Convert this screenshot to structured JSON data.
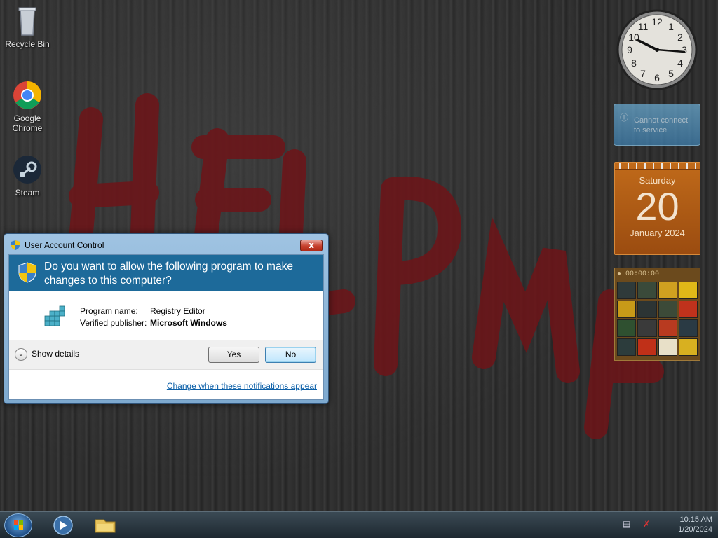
{
  "desktop": {
    "icons": [
      {
        "label": "Recycle Bin",
        "icon": "recycle-bin-icon"
      },
      {
        "label": "Google Chrome",
        "icon": "chrome-icon"
      },
      {
        "label": "Steam",
        "icon": "steam-icon"
      }
    ],
    "wallpaper_text": "HELP ME"
  },
  "gadgets": {
    "clock": {
      "numerals": [
        "12",
        "1",
        "2",
        "3",
        "4",
        "5",
        "6",
        "7",
        "8",
        "9",
        "10",
        "11"
      ],
      "time": "10:15"
    },
    "notice": {
      "text": "Cannot connect to service"
    },
    "calendar": {
      "day_name": "Saturday",
      "day": "20",
      "month_year": "January 2024"
    },
    "puzzle": {
      "timer": "00:00:00"
    }
  },
  "uac": {
    "title": "User Account Control",
    "close_label": "x",
    "question": "Do you want to allow the following program to make changes to this computer?",
    "program_name_label": "Program name:",
    "program_name_value": "Registry Editor",
    "publisher_label": "Verified publisher:",
    "publisher_value": "Microsoft Windows",
    "details_label": "Show details",
    "yes_label": "Yes",
    "no_label": "No",
    "link_label": "Change when these notifications appear"
  },
  "taskbar": {
    "items": [
      "start-orb",
      "media-player",
      "windows-explorer"
    ],
    "time": "10:15 AM",
    "date": "1/20/2024"
  },
  "colors": {
    "uac_header": "#1d6a9a",
    "link": "#0b5fa8",
    "taskbar": "#1d2830"
  }
}
